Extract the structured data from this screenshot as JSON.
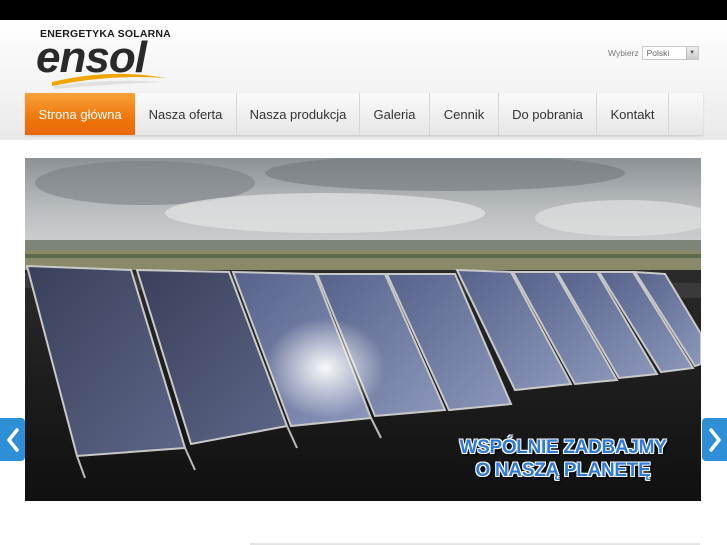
{
  "header": {
    "logo_tagline": "ENERGETYKA SOLARNA",
    "logo_word": "ensol",
    "language": {
      "label": "Wybierz",
      "selected": "Polski"
    }
  },
  "nav": {
    "items": [
      {
        "label": "Strona główna",
        "active": true
      },
      {
        "label": "Nasza oferta",
        "active": false
      },
      {
        "label": "Nasza produkcja",
        "active": false
      },
      {
        "label": "Galeria",
        "active": false
      },
      {
        "label": "Cennik",
        "active": false
      },
      {
        "label": "Do pobrania",
        "active": false
      },
      {
        "label": "Kontakt",
        "active": false
      }
    ]
  },
  "slider": {
    "slogan_line1": "WSPÓLNIE ZADBAJMY",
    "slogan_line2": "O NASZĄ PLANETĘ",
    "prev_icon": "chevron-left-icon",
    "next_icon": "chevron-right-icon"
  },
  "colors": {
    "accent": "#f07a10",
    "arrow": "#2e8fd6",
    "slogan": "#2f7ad9"
  }
}
